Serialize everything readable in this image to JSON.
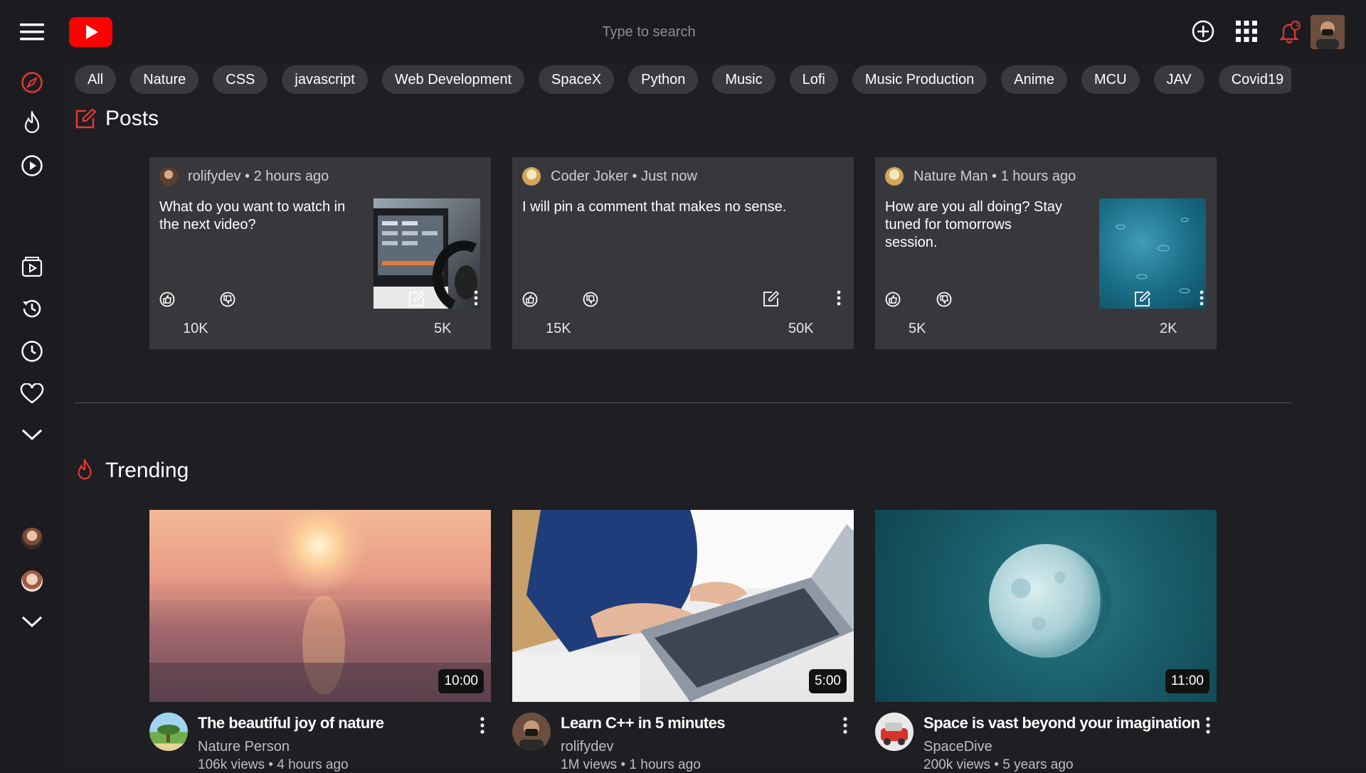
{
  "search": {
    "placeholder": "Type to search"
  },
  "chips": [
    "All",
    "Nature",
    "CSS",
    "javascript",
    "Web Development",
    "SpaceX",
    "Python",
    "Music",
    "Lofi",
    "Music Production",
    "Anime",
    "MCU",
    "JAV",
    "Covid19"
  ],
  "sections": {
    "posts_title": "Posts",
    "trending_title": "Trending"
  },
  "posts": [
    {
      "author": "rolifydev",
      "time": "2 hours ago",
      "text": "What do you want to watch in the next video?",
      "likes": "10K",
      "comments": "5K",
      "has_thumb": true
    },
    {
      "author": "Coder Joker",
      "time": "Just now",
      "text": "I will pin a comment that makes no sense.",
      "likes": "15K",
      "comments": "50K",
      "has_thumb": false
    },
    {
      "author": "Nature Man",
      "time": "1 hours ago",
      "text": "How are you all doing? Stay tuned for tomorrows session.",
      "likes": "5K",
      "comments": "2K",
      "has_thumb": true
    }
  ],
  "videos": [
    {
      "title": "The beautiful joy of nature",
      "channel": "Nature Person",
      "views": "106k views",
      "age": "4 hours ago",
      "duration": "10:00"
    },
    {
      "title": "Learn C++ in 5 minutes",
      "channel": "rolifydev",
      "views": "1M views",
      "age": "1 hours ago",
      "duration": "5:00"
    },
    {
      "title": "Space is vast beyond your imagination",
      "channel": "SpaceDive",
      "views": "200k views",
      "age": "5 years ago",
      "duration": "11:00"
    }
  ],
  "notifications": {
    "badge": "1"
  },
  "colors": {
    "brand_red": "#ff0000",
    "accent_red": "#e53935",
    "background": "#1c1c20",
    "card": "#38383c",
    "chip": "#3a3a3e"
  },
  "icons": {
    "menu": "hamburger-menu-icon",
    "logo": "play-logo-icon",
    "explore": "compass-icon",
    "trending": "flame-icon",
    "subscriptions": "play-circle-icon",
    "library": "video-library-icon",
    "history": "history-icon",
    "watch_later": "clock-icon",
    "liked": "heart-icon",
    "create": "plus-circle-icon",
    "apps": "grid-apps-icon",
    "notifications": "bell-icon"
  }
}
